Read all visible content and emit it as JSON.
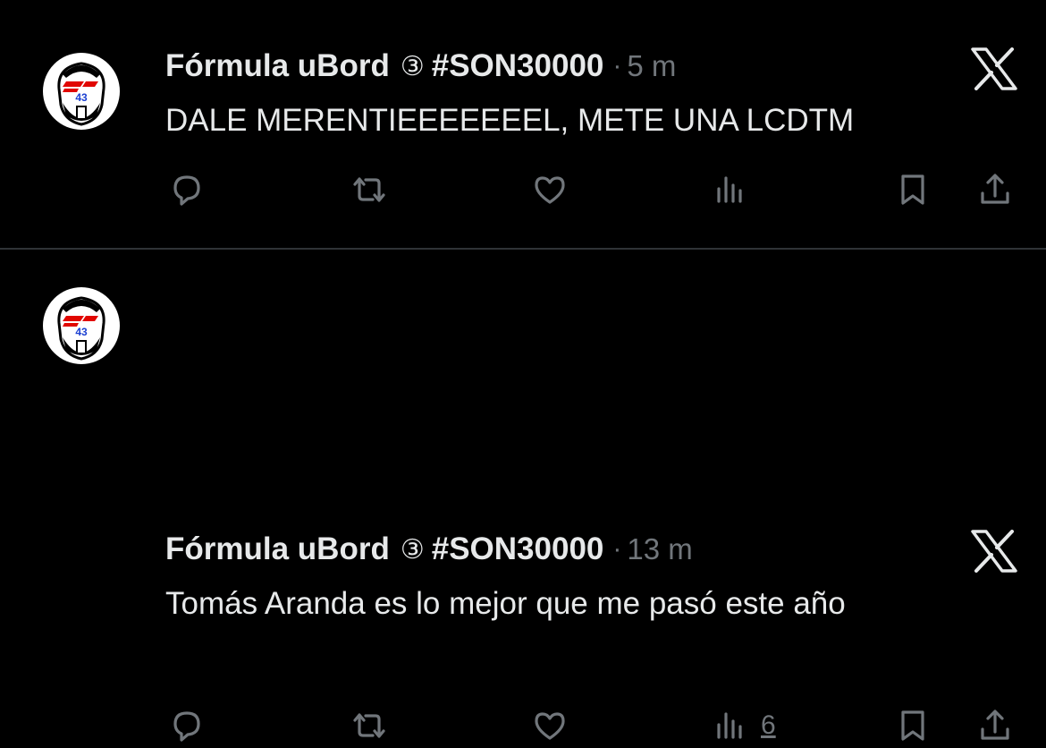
{
  "tweets": [
    {
      "author": "Fórmula uBord",
      "badge": "③",
      "hashtag": "#SON30000",
      "separator": "·",
      "time": "5 m",
      "text": "DALE MERENTIEEEEEEEL, METE UNA LCDTM",
      "views_count": "",
      "avatar_number": "43"
    },
    {
      "author": "Fórmula uBord",
      "badge": "③",
      "hashtag": "#SON30000",
      "separator": "·",
      "time": "13 m",
      "text": "Tomás Aranda es lo mejor que me pasó este año",
      "views_count": "6",
      "avatar_number": "43"
    }
  ],
  "icons": {
    "reply": "reply-icon",
    "retweet": "retweet-icon",
    "like": "heart-icon",
    "views": "views-icon",
    "bookmark": "bookmark-icon",
    "share": "share-icon",
    "x": "x-logo-icon"
  },
  "colors": {
    "background": "#000000",
    "text": "#e7e9ea",
    "secondary": "#71767b",
    "divider": "#2f3336",
    "avatar_red": "#e10600",
    "avatar_number": "#1a3fd1"
  }
}
